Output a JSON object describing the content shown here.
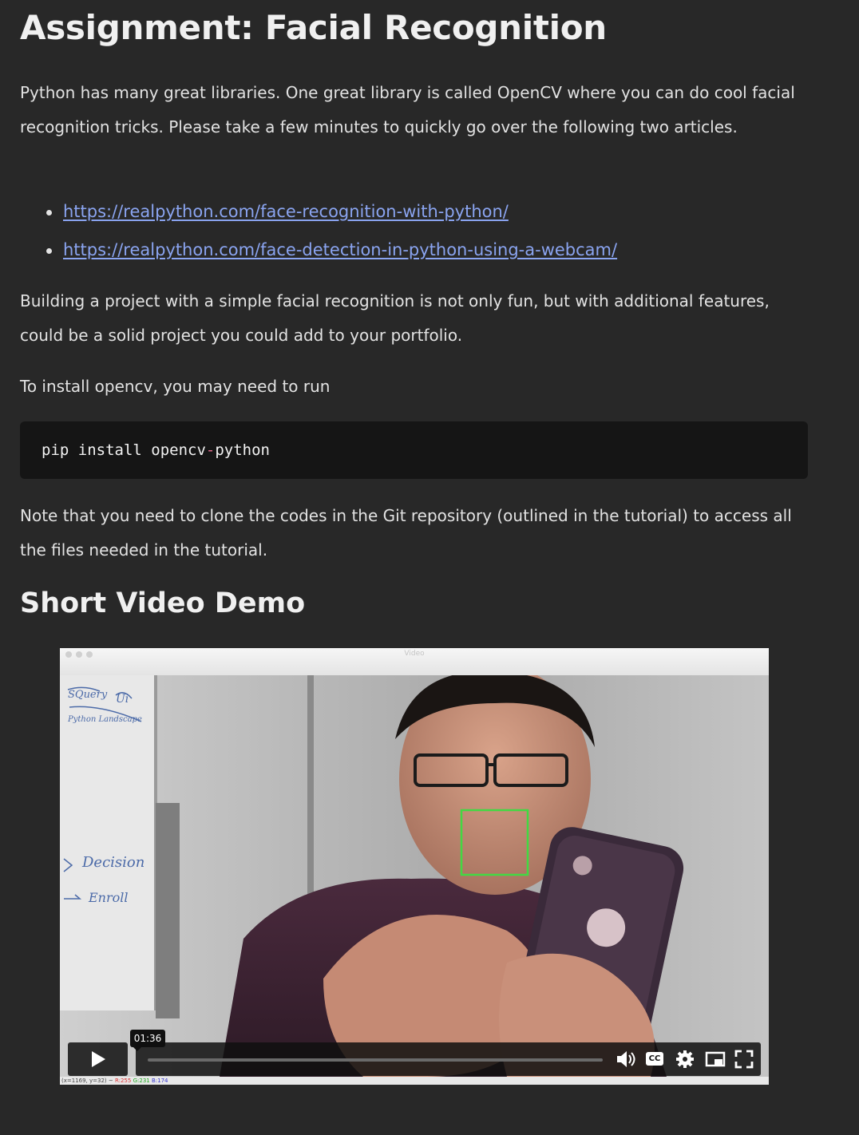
{
  "title": "Assignment: Facial Recognition",
  "intro": "Python has many great libraries.  One great library is called OpenCV where you can do cool facial recognition tricks.  Please take a few minutes to quickly go over the following two articles.",
  "links": [
    "https://realpython.com/face-recognition-with-python/",
    "https://realpython.com/face-detection-in-python-using-a-webcam/"
  ],
  "para2": "Building a project with a simple facial recognition is not only fun, but with additional features, could be a solid project you could add to your portfolio.",
  "para3": "To install opencv, you may need to run",
  "code": {
    "part1": "pip install opencv",
    "op": "-",
    "part2": "python"
  },
  "para4": "Note that you need to clone the codes in the Git repository (outlined in the tutorial) to access all the files needed in the tutorial.",
  "section_title": "Short Video Demo",
  "video": {
    "window_title": "Video",
    "timestamp": "01:36",
    "cc_label": "CC",
    "status": {
      "coords": "(x=1169, y=32) ~ ",
      "r": "R:255",
      "g": "G:231",
      "b": "B:174"
    },
    "progress": 0.0,
    "whiteboard_text": [
      "SQuery",
      "Ui",
      "Python Landscape",
      "Decision",
      "Enroll"
    ]
  }
}
